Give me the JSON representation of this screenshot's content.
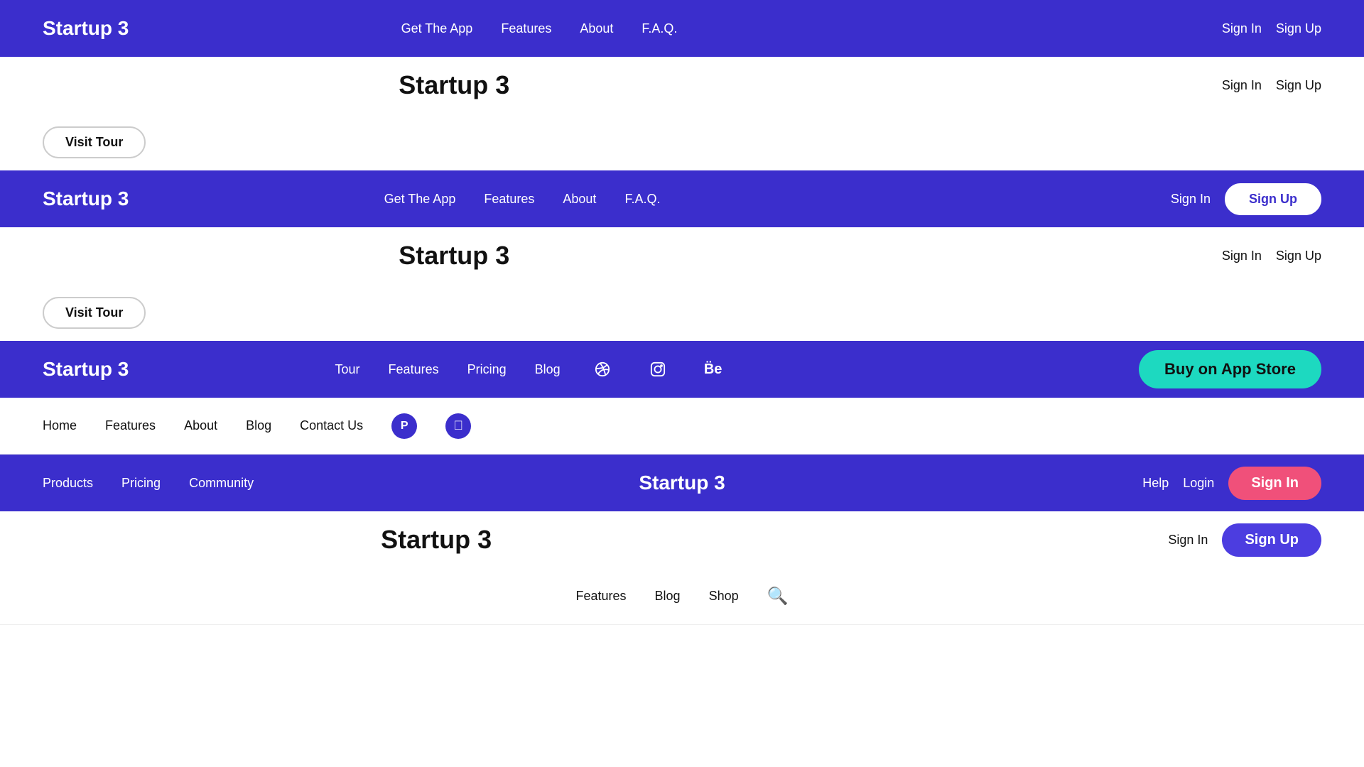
{
  "navbars": [
    {
      "id": "navbar-1",
      "theme": "dark",
      "brand": "Startup 3",
      "links": [
        "Get The App",
        "Features",
        "About",
        "F.A.Q."
      ],
      "actions": [
        "Sign In",
        "Sign Up"
      ],
      "action_style": "text_and_text"
    },
    {
      "id": "content-1",
      "theme": "light",
      "title": "Startup 3",
      "left_btn": null,
      "right_actions": [
        "Sign In",
        "Sign Up"
      ],
      "right_style": "text_and_text"
    },
    {
      "id": "content-2",
      "theme": "light",
      "left_btn": "Visit Tour",
      "title": null,
      "right_actions": [],
      "right_style": null
    },
    {
      "id": "navbar-2",
      "theme": "dark",
      "brand": "Startup 3",
      "links": [
        "Get The App",
        "Features",
        "About",
        "F.A.Q."
      ],
      "actions": [
        "Sign In",
        "Sign Up"
      ],
      "action_style": "text_and_outline"
    },
    {
      "id": "content-3",
      "theme": "light",
      "title": "Startup 3",
      "left_btn": null,
      "right_actions": [
        "Sign In",
        "Sign Up"
      ],
      "right_style": "text_and_text"
    },
    {
      "id": "content-4",
      "theme": "light",
      "left_btn": "Visit Tour",
      "title": null,
      "right_actions": [],
      "right_style": null
    },
    {
      "id": "navbar-3",
      "theme": "dark",
      "brand": "Startup 3",
      "links": [
        "Tour",
        "Features",
        "Pricing",
        "Blog"
      ],
      "social_icons": [
        "dribbble",
        "instagram",
        "behance"
      ],
      "cta": "Buy on App Store",
      "cta_style": "teal"
    },
    {
      "id": "navbar-4",
      "theme": "light",
      "brand": null,
      "links": [
        "Home",
        "Features",
        "About",
        "Blog",
        "Contact Us"
      ],
      "social_icons": [
        "producthunt",
        "apple"
      ],
      "actions": [],
      "action_style": null
    },
    {
      "id": "navbar-5",
      "theme": "dark",
      "brand": "Startup 3",
      "left_links": [
        "Products",
        "Pricing",
        "Community"
      ],
      "actions": [
        "Help",
        "Login",
        "Sign In"
      ],
      "action_style": "text_text_pink"
    },
    {
      "id": "content-5",
      "theme": "light",
      "title": "Startup 3",
      "right_actions": [
        "Sign In",
        "Sign Up"
      ],
      "right_style": "text_and_purple"
    },
    {
      "id": "navbar-6-partial",
      "theme": "light",
      "links": [
        "Features",
        "Blog",
        "Shop"
      ],
      "search": true,
      "actions": []
    }
  ],
  "labels": {
    "brand_1": "Startup 3",
    "brand_2": "Startup 3",
    "brand_3": "Startup 3",
    "brand_4": "Startup 3",
    "brand_5": "Startup 3",
    "get_app": "Get The App",
    "features": "Features",
    "about": "About",
    "faq": "F.A.Q.",
    "tour": "Tour",
    "pricing": "Pricing",
    "blog": "Blog",
    "home": "Home",
    "contact_us": "Contact Us",
    "products": "Products",
    "community": "Community",
    "shop": "Shop",
    "sign_in": "Sign In",
    "sign_up": "Sign Up",
    "login": "Login",
    "help": "Help",
    "visit_tour": "Visit Tour",
    "buy_app_store": "Buy on App Store",
    "title_1": "Startup 3",
    "title_2": "Startup 3",
    "title_3": "Startup 3",
    "title_4": "Startup 3"
  }
}
